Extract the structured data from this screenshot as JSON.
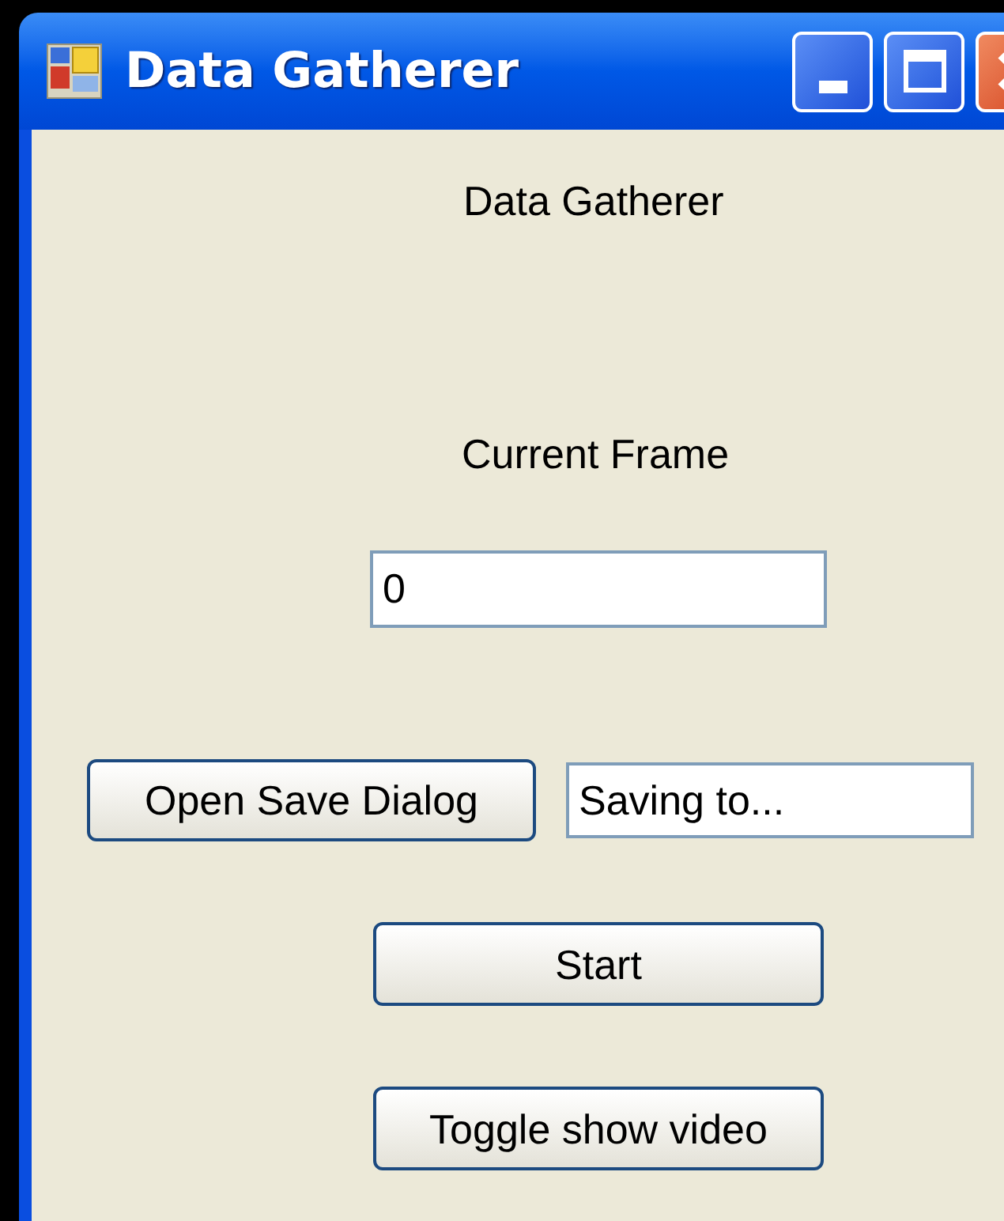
{
  "window": {
    "title": "Data Gatherer"
  },
  "heading": "Data Gatherer",
  "frame_label": "Current Frame",
  "frame_field": {
    "value": "0"
  },
  "save_button": "Open Save Dialog",
  "save_path_field": {
    "value": "Saving to..."
  },
  "start_button": "Start",
  "toggle_button": "Toggle show video"
}
